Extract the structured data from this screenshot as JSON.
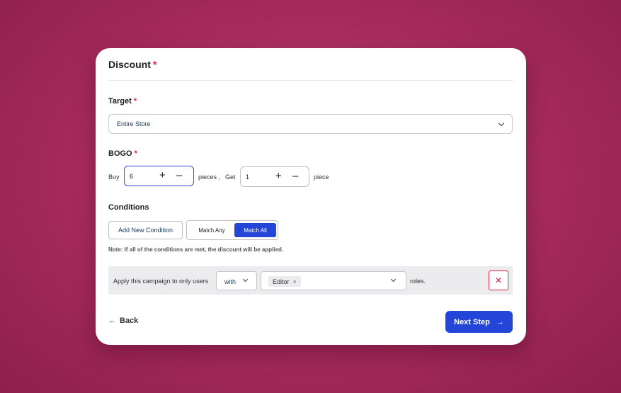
{
  "card": {
    "title": "Discount",
    "required_mark": "*"
  },
  "target": {
    "label": "Target",
    "required_mark": "*",
    "selected": "Entire Store"
  },
  "bogo": {
    "label": "BOGO",
    "required_mark": "*",
    "buy_label": "Buy",
    "buy_value": "6",
    "pieces_label": "pieces ,",
    "get_label": "Get",
    "get_value": "1",
    "piece_label": "piece",
    "plus_icon": "+",
    "minus_icon": "–"
  },
  "conditions": {
    "label": "Conditions",
    "add_button": "Add New Condition",
    "match_any": "Match Any",
    "match_all": "Match All",
    "active_match": "Match All",
    "note": "Note: If all of the conditions are met, the discount will be applied."
  },
  "condition_row": {
    "prefix": "Apply this campaign to only users",
    "operator": "with",
    "roles": [
      "Editor"
    ],
    "tag_remove": "×",
    "suffix": "roles.",
    "delete_icon": "✕"
  },
  "footer": {
    "back_icon": "←",
    "back_label": "Back",
    "next_label": "Next Step",
    "next_icon": "→"
  },
  "colors": {
    "background": "#a42a5a",
    "primary": "#2446d8",
    "danger": "#e0243a"
  }
}
